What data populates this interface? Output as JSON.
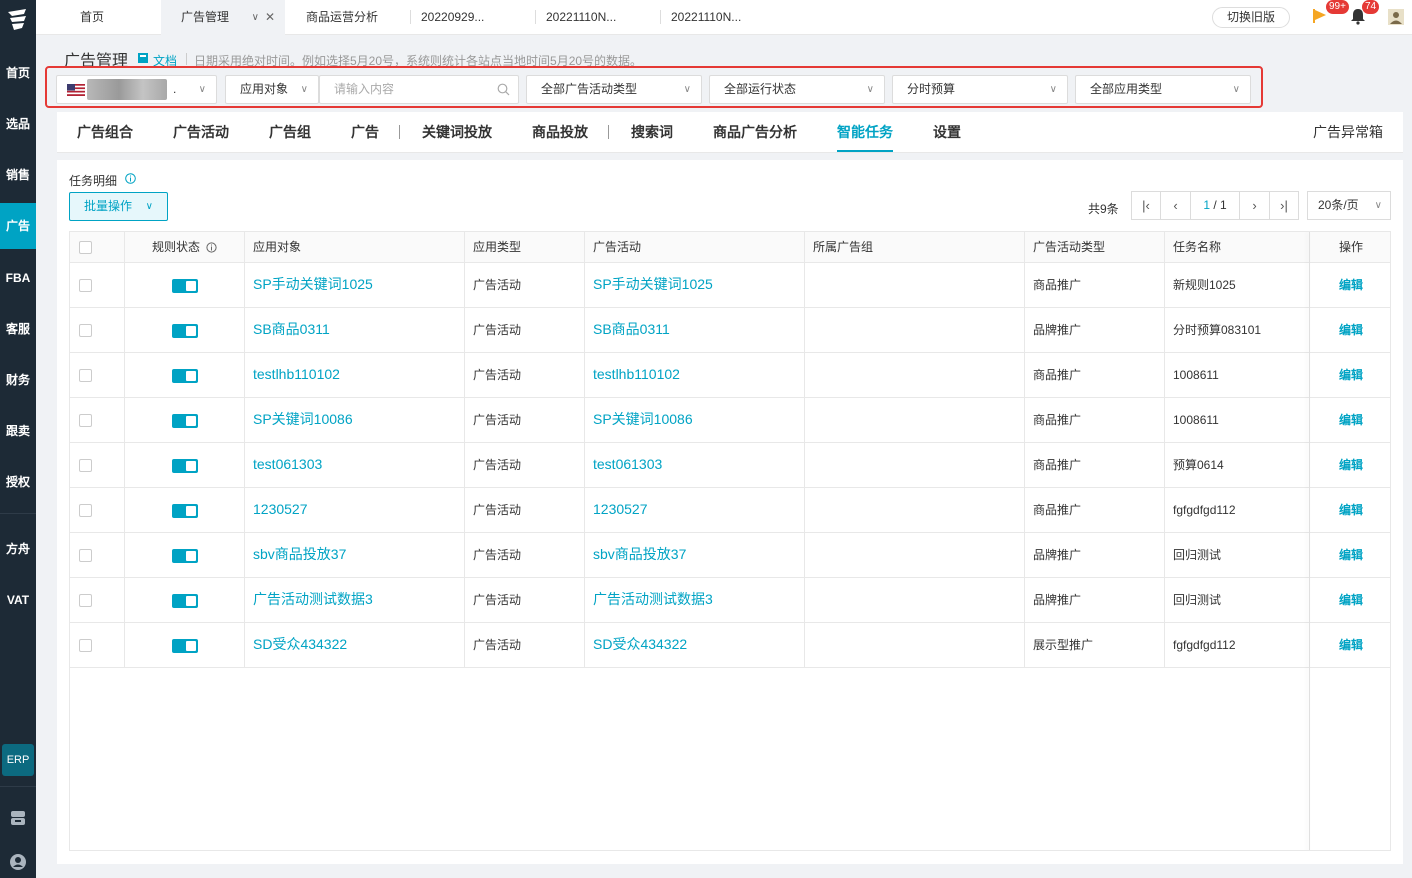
{
  "sidebar": {
    "items": [
      {
        "label": "首页",
        "active": false
      },
      {
        "label": "选品",
        "active": false
      },
      {
        "label": "销售",
        "active": false
      },
      {
        "label": "广告",
        "active": true
      },
      {
        "label": "FBA",
        "active": false
      },
      {
        "label": "客服",
        "active": false
      },
      {
        "label": "财务",
        "active": false
      },
      {
        "label": "跟卖",
        "active": false
      },
      {
        "label": "授权",
        "active": false
      },
      {
        "label": "方舟",
        "active": false
      },
      {
        "label": "VAT",
        "active": false
      }
    ],
    "erp_label": "ERP"
  },
  "topbar": {
    "tabs": [
      {
        "label": "首页"
      },
      {
        "label": "广告管理"
      },
      {
        "label": "商品运营分析"
      },
      {
        "label": "20220929..."
      },
      {
        "label": "20221110N..."
      },
      {
        "label": "20221110N..."
      }
    ],
    "switch_old_label": "切换旧版",
    "flag_badge": "99+",
    "bell_badge": "74"
  },
  "header": {
    "title": "广告管理",
    "doc_label": "文档",
    "note": "日期采用绝对时间。例如选择5月20号，系统则统计各站点当地时间5月20号的数据。"
  },
  "filters": {
    "shop_suffix": ".",
    "apply_target": "应用对象",
    "search_placeholder": "请输入内容",
    "campaign_type": "全部广告活动类型",
    "run_status": "全部运行状态",
    "budget": "分时预算",
    "apply_type": "全部应用类型"
  },
  "navtabs": {
    "items": [
      "广告组合",
      "广告活动",
      "广告组",
      "广告",
      "关键词投放",
      "商品投放",
      "搜索词",
      "商品广告分析",
      "智能任务",
      "设置"
    ],
    "active": "智能任务",
    "right_label": "广告异常箱"
  },
  "content": {
    "section_title": "任务明细",
    "batch_label": "批量操作",
    "total": "共9条",
    "page_current": "1",
    "page_total": "/ 1",
    "page_size": "20条/页"
  },
  "table": {
    "headers": [
      "规则状态",
      "应用对象",
      "应用类型",
      "广告活动",
      "所属广告组",
      "广告活动类型",
      "任务名称",
      "操作"
    ],
    "rows": [
      {
        "target": "SP手动关键词1025",
        "type": "广告活动",
        "campaign": "SP手动关键词1025",
        "group": "",
        "campaign_type": "商品推广",
        "task": "新规则1025",
        "op": "编辑"
      },
      {
        "target": "SB商品0311",
        "type": "广告活动",
        "campaign": "SB商品0311",
        "group": "",
        "campaign_type": "品牌推广",
        "task": "分时预算083101",
        "op": "编辑"
      },
      {
        "target": "testlhb110102",
        "type": "广告活动",
        "campaign": "testlhb110102",
        "group": "",
        "campaign_type": "商品推广",
        "task": "1008611",
        "op": "编辑"
      },
      {
        "target": "SP关键词10086",
        "type": "广告活动",
        "campaign": "SP关键词10086",
        "group": "",
        "campaign_type": "商品推广",
        "task": "1008611",
        "op": "编辑"
      },
      {
        "target": "test061303",
        "type": "广告活动",
        "campaign": "test061303",
        "group": "",
        "campaign_type": "商品推广",
        "task": "预算0614",
        "op": "编辑"
      },
      {
        "target": "1230527",
        "type": "广告活动",
        "campaign": "1230527",
        "group": "",
        "campaign_type": "商品推广",
        "task": "fgfgdfgd112",
        "op": "编辑"
      },
      {
        "target": "sbv商品投放37",
        "type": "广告活动",
        "campaign": "sbv商品投放37",
        "group": "",
        "campaign_type": "品牌推广",
        "task": "回归测试",
        "op": "编辑"
      },
      {
        "target": "广告活动测试数据3",
        "type": "广告活动",
        "campaign": "广告活动测试数据3",
        "group": "",
        "campaign_type": "品牌推广",
        "task": "回归测试",
        "op": "编辑"
      },
      {
        "target": "SD受众434322",
        "type": "广告活动",
        "campaign": "SD受众434322",
        "group": "",
        "campaign_type": "展示型推广",
        "task": "fgfgdfgd112",
        "op": "编辑"
      }
    ]
  },
  "colors": {
    "accent": "#00a3c4",
    "sidebar_bg": "#1d2a36",
    "highlight_border": "#e53935"
  }
}
